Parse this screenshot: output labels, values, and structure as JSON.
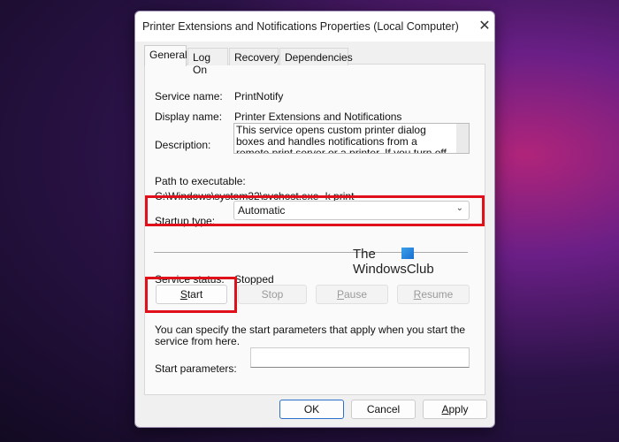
{
  "window": {
    "title": "Printer Extensions and Notifications Properties (Local Computer)",
    "close_icon": "close-icon"
  },
  "tabs": [
    {
      "label": "General",
      "active": true
    },
    {
      "label": "Log On"
    },
    {
      "label": "Recovery"
    },
    {
      "label": "Dependencies"
    }
  ],
  "general": {
    "service_name_label": "Service name:",
    "service_name": "PrintNotify",
    "display_name_label": "Display name:",
    "display_name": "Printer Extensions and Notifications",
    "description_label": "Description:",
    "description": "This service opens custom printer dialog boxes and handles notifications from a remote print server or a printer. If you turn off this service, you won't be able",
    "path_label": "Path to executable:",
    "path": "C:\\Windows\\system32\\svchost.exe -k print",
    "startup_type_label": "Startup type:",
    "startup_type": "Automatic",
    "service_status_label": "Service status:",
    "service_status": "Stopped",
    "buttons": {
      "start": "Start",
      "stop": "Stop",
      "pause": "Pause",
      "resume": "Resume"
    },
    "hint": "You can specify the start parameters that apply when you start the service from here.",
    "start_params_label": "Start parameters:",
    "start_params_value": ""
  },
  "footer": {
    "ok": "OK",
    "cancel": "Cancel",
    "apply": "Apply"
  },
  "watermark": {
    "line1": "The",
    "line2": "WindowsClub"
  },
  "colors": {
    "highlight": "#e0101a",
    "accent": "#2a6fc8"
  }
}
